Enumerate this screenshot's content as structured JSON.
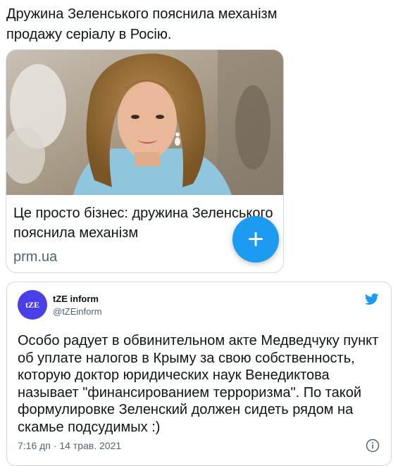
{
  "embedded_tweet": {
    "headline": "Дружина Зеленського пояснила механізм продажу серіалу в Росію.",
    "card": {
      "title": "Це просто бізнес: дружина Зеленського пояснила механізм",
      "domain": "prm.ua"
    }
  },
  "fab": {
    "symbol": "+"
  },
  "tweet": {
    "avatar_text": "tZE",
    "display_name": "tZE inform",
    "handle": "@tZEinform",
    "body": "Особо радует в обвинительном акте Медведчуку пункт об уплате налогов в Крыму за свою собственность, которую доктор юридических наук Венедиктова называет \"финансированием терроризма\". По такой формулировке Зеленский должен сидеть рядом на скамье подсудимых :)",
    "timestamp": "7:16 дп · 14 трав. 2021"
  },
  "colors": {
    "accent": "#1d9bf0",
    "avatar_bg": "#4a3fe6",
    "secondary_text": "#536471",
    "border": "#cfd9de"
  },
  "icons": {
    "brand": "twitter-bird-icon",
    "info": "info-icon",
    "add": "plus-icon"
  }
}
